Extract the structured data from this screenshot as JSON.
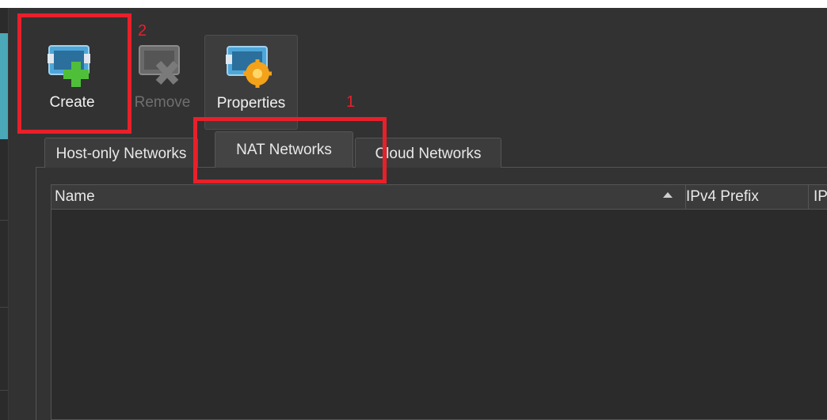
{
  "toolbar": {
    "create_label": "Create",
    "remove_label": "Remove",
    "properties_label": "Properties"
  },
  "tabs": [
    {
      "label": "Host-only Networks"
    },
    {
      "label": "NAT Networks"
    },
    {
      "label": "Cloud Networks"
    }
  ],
  "table": {
    "columns": [
      "Name",
      "IPv4 Prefix",
      "IP"
    ]
  },
  "annotations": {
    "step1": "1",
    "step2": "2"
  },
  "colors": {
    "highlight": "#e8202a",
    "background": "#2f2f30",
    "accent": "#4aa8b8"
  },
  "icons": [
    "network-add-icon",
    "network-remove-icon",
    "network-properties-icon",
    "sort-ascending-icon"
  ]
}
